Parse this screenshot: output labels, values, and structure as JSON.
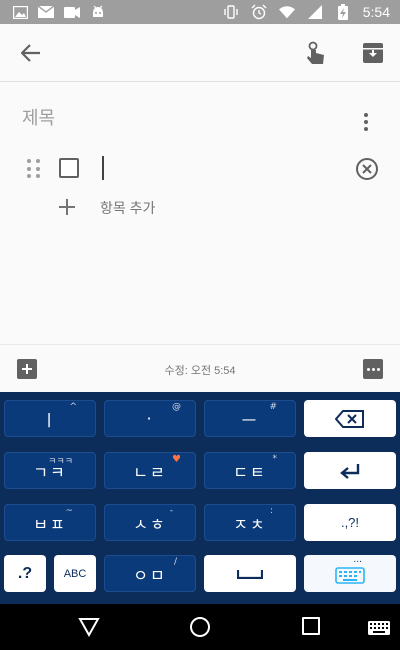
{
  "status_bar": {
    "time": "5:54",
    "icons_left": [
      "image-icon",
      "mail-icon",
      "video-icon",
      "android-icon"
    ],
    "icons_right": [
      "vibrate-icon",
      "alarm-icon",
      "wifi-icon",
      "cell-signal-icon",
      "battery-charging-icon"
    ]
  },
  "appbar": {
    "back_icon": "arrow-back-icon",
    "actions": [
      "touch-gesture-icon",
      "archive-icon"
    ]
  },
  "note": {
    "title_placeholder": "제목",
    "items": [
      {
        "checked": false,
        "text": ""
      }
    ],
    "add_item_label": "항목 추가"
  },
  "toolbar": {
    "edited_label": "수정: 오전 5:54"
  },
  "keyboard": {
    "rows": [
      [
        {
          "main": "ㅣ",
          "sub": "^"
        },
        {
          "main": "·",
          "sub": "@"
        },
        {
          "main": "ㅡ",
          "sub": "#"
        },
        {
          "main": "backspace"
        }
      ],
      [
        {
          "main": "ㄱㅋ",
          "sub": "ㅋㅋㅋ"
        },
        {
          "main": "ㄴㄹ",
          "sub": "♥"
        },
        {
          "main": "ㄷㅌ",
          "sub": "*"
        },
        {
          "main": "enter"
        }
      ],
      [
        {
          "main": "ㅂㅍ",
          "sub": "~"
        },
        {
          "main": "ㅅㅎ",
          "sub": "-"
        },
        {
          "main": "ㅈㅊ",
          "sub": ":"
        },
        {
          "main": ".,?!"
        }
      ],
      [
        {
          "main": ".?"
        },
        {
          "main": "ABC"
        },
        {
          "main": "ㅇㅁ",
          "sub": "/"
        },
        {
          "main": "space"
        },
        {
          "main": "keyboard-settings",
          "sub": "..."
        }
      ]
    ]
  },
  "navbar": {
    "buttons": [
      "back-triangle-icon",
      "home-circle-icon",
      "recents-square-icon",
      "keyboard-switch-icon"
    ]
  },
  "colors": {
    "keyboard_bg": "#0c2c59",
    "key_dark": "#0b3a7a",
    "key_light": "#ffffff",
    "status_bar": "#9e9e9e",
    "heart_accent": "#ff7043"
  }
}
